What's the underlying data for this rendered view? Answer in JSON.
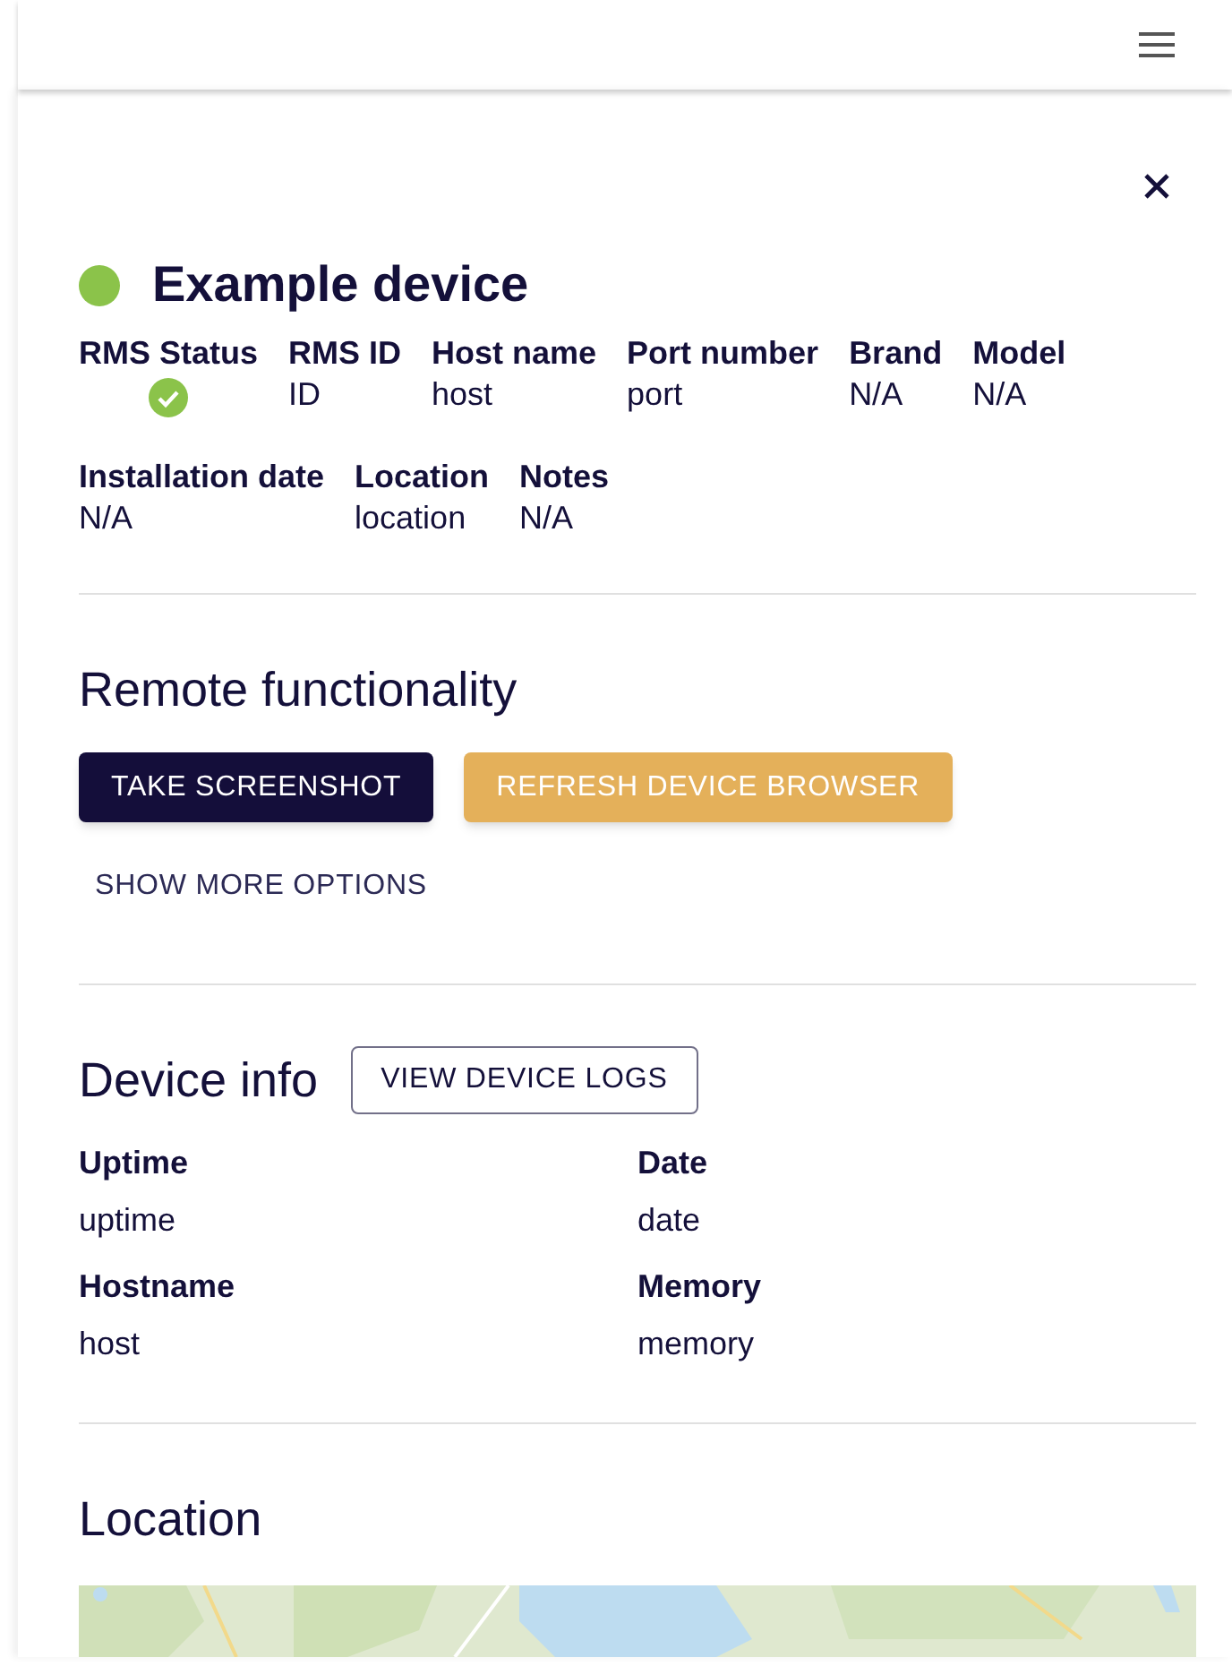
{
  "device": {
    "title": "Example device",
    "online": true
  },
  "fields_row_1": [
    {
      "label": "RMS Status",
      "kind": "status",
      "ok": true
    },
    {
      "label": "RMS ID",
      "kind": "text",
      "value": "ID"
    },
    {
      "label": "Host name",
      "kind": "text",
      "value": "host"
    },
    {
      "label": "Port number",
      "kind": "text",
      "value": "port"
    },
    {
      "label": "Brand",
      "kind": "text",
      "value": "N/A"
    },
    {
      "label": "Model",
      "kind": "text",
      "value": "N/A"
    }
  ],
  "fields_row_2": [
    {
      "label": "Installation date",
      "kind": "text",
      "value": "N/A"
    },
    {
      "label": "Location",
      "kind": "text",
      "value": "location"
    },
    {
      "label": "Notes",
      "kind": "text",
      "value": "N/A"
    }
  ],
  "remote_functionality": {
    "heading": "Remote functionality",
    "buttons": [
      {
        "label": "TAKE SCREENSHOT",
        "kind": "primary"
      },
      {
        "label": "REFRESH DEVICE BROWSER",
        "kind": "warning"
      }
    ],
    "more": "SHOW MORE OPTIONS"
  },
  "device_info": {
    "heading": "Device info",
    "logs_button": "VIEW DEVICE LOGS",
    "items": [
      {
        "label": "Uptime",
        "value": "uptime"
      },
      {
        "label": "Date",
        "value": "date"
      },
      {
        "label": "Hostname",
        "value": "host"
      },
      {
        "label": "Memory",
        "value": "memory"
      }
    ]
  },
  "location": {
    "heading": "Location"
  }
}
